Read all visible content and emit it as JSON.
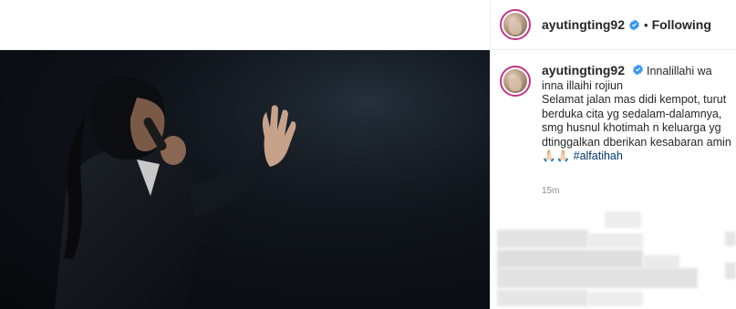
{
  "post": {
    "username": "ayutingting92",
    "follow_status": "Following",
    "separator": "•",
    "caption": {
      "username": "ayutingting92",
      "line1": "Innalillahi wa inna illaihi rojiun",
      "line2": "Selamat jalan mas didi kempot, turut berduka cita yg sedalam-dalamnya, smg husnul khotimah n keluarga yg dtinggalkan dberikan kesabaran amin",
      "emoji": "🙏🏻🙏🏻",
      "hashtag": "#alfatihah"
    },
    "timestamp": "15m"
  },
  "icons": {
    "verified": "verified-badge-icon"
  },
  "colors": {
    "text": "#262626",
    "link": "#00376b",
    "verified": "#3897f0",
    "muted": "#8e8e8e"
  }
}
